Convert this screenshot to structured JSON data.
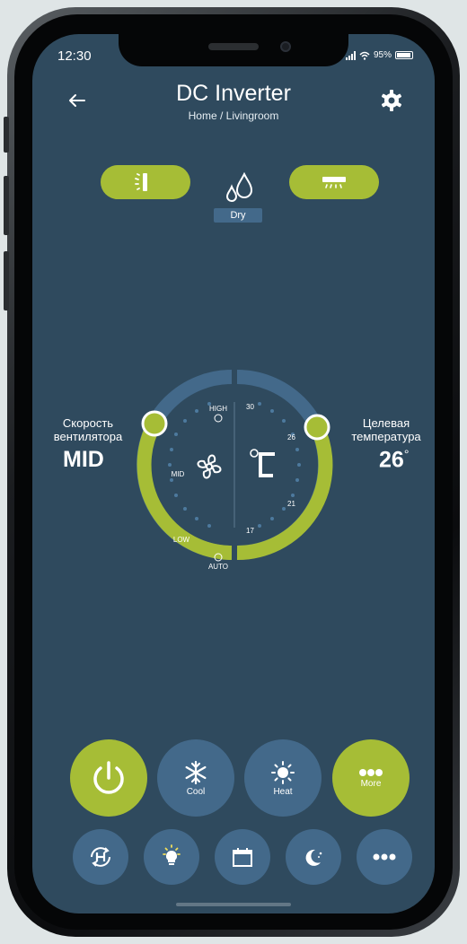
{
  "status": {
    "time": "12:30",
    "battery": "95%"
  },
  "header": {
    "title": "DC Inverter",
    "subtitle": "Home / Livingroom"
  },
  "mode": {
    "current": "Dry"
  },
  "fan": {
    "label_line1": "Скорость",
    "label_line2": "вентилятора",
    "value": "MID",
    "ticks": [
      "HIGH",
      "MID",
      "LOW",
      "AUTO"
    ]
  },
  "temperature": {
    "label_line1": "Целевая",
    "label_line2": "температура",
    "value": "26",
    "degree": "°",
    "ticks": [
      "30",
      "26",
      "21",
      "17"
    ],
    "unit_symbol": "°C"
  },
  "controls": {
    "cool_label": "Cool",
    "heat_label": "Heat",
    "more_label": "More"
  },
  "colors": {
    "accent": "#a6bd36",
    "background": "#2f4a5e",
    "button": "#43698a"
  }
}
